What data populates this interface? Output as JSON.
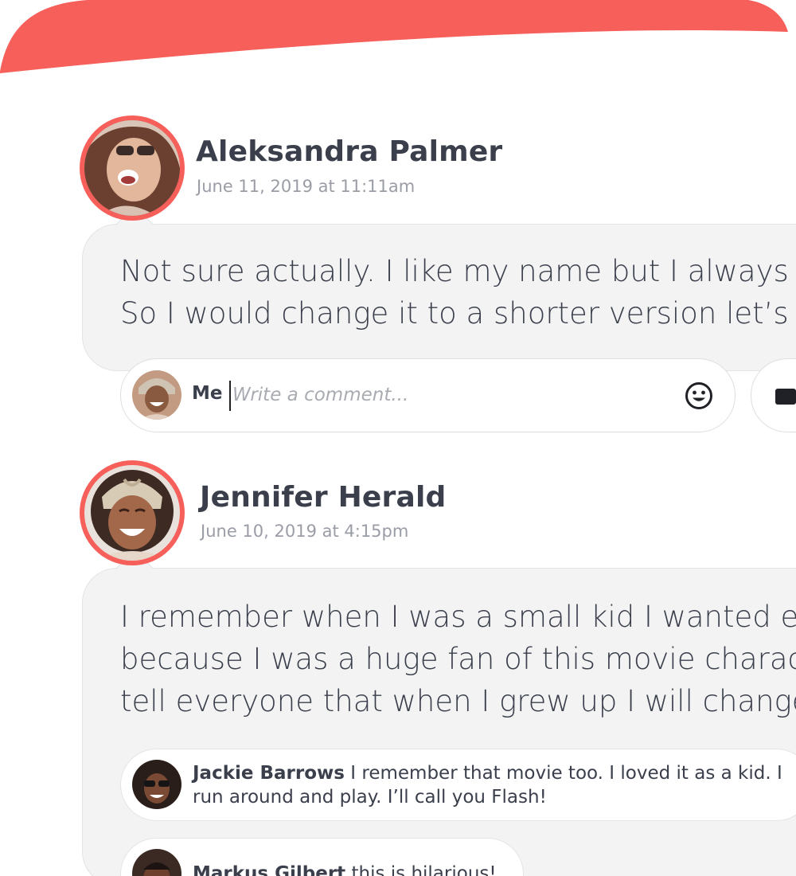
{
  "colors": {
    "accent": "#f65f5a",
    "bubble": "#f3f3f4",
    "text": "#3a3f4b",
    "muted": "#9a9da6"
  },
  "posts": [
    {
      "author": "Aleksandra Palmer",
      "date": "June 11, 2019 at 11:11am",
      "lines": [
        "Not sure actually. I like my name but I always w",
        "So I would change it to a shorter version let’s s"
      ]
    },
    {
      "author": "Jennifer Herald",
      "date": "June 10, 2019 at 4:15pm",
      "lines": [
        "I remember when I was a small kid I wanted ev",
        "because I was a huge fan of this movie charact",
        "tell everyone that when I grew up I will change"
      ]
    }
  ],
  "comment_input": {
    "me_label": "Me",
    "placeholder": "Write a comment..."
  },
  "replies": [
    {
      "author": "Jackie Barrows",
      "line1": "I remember that movie too. I loved it as a kid. I",
      "line2": "run around and play. I’ll call you Flash!"
    },
    {
      "author": "Markus Gilbert",
      "line1": "this is hilarious!"
    }
  ],
  "icons": {
    "emoji": "smiley-icon",
    "media": "camera-icon"
  }
}
